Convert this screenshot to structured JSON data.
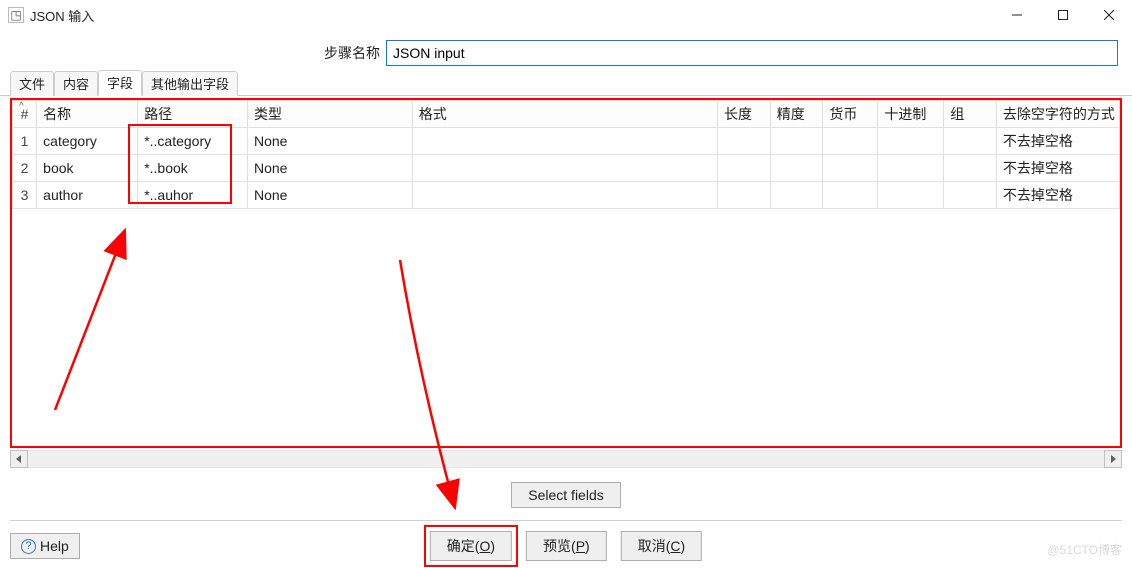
{
  "window": {
    "title": "JSON 输入",
    "minimize": "–",
    "maximize": "☐",
    "close": "✕"
  },
  "step": {
    "label": "步骤名称",
    "value": "JSON input"
  },
  "tabs": [
    {
      "label": "文件",
      "active": false
    },
    {
      "label": "内容",
      "active": false
    },
    {
      "label": "字段",
      "active": true
    },
    {
      "label": "其他输出字段",
      "active": false
    }
  ],
  "table": {
    "headers": {
      "idx": "#",
      "name": "名称",
      "path": "路径",
      "type": "类型",
      "format": "格式",
      "length": "长度",
      "precision": "精度",
      "currency": "货币",
      "decimal": "十进制",
      "group": "组",
      "trim": "去除空字符的方式"
    },
    "rows": [
      {
        "idx": "1",
        "name": "category",
        "path": "*..category",
        "type": "None",
        "format": "",
        "length": "",
        "precision": "",
        "currency": "",
        "decimal": "",
        "group": "",
        "trim": "不去掉空格"
      },
      {
        "idx": "2",
        "name": "book",
        "path": "*..book",
        "type": "None",
        "format": "",
        "length": "",
        "precision": "",
        "currency": "",
        "decimal": "",
        "group": "",
        "trim": "不去掉空格"
      },
      {
        "idx": "3",
        "name": "author",
        "path": "*..auhor",
        "type": "None",
        "format": "",
        "length": "",
        "precision": "",
        "currency": "",
        "decimal": "",
        "group": "",
        "trim": "不去掉空格"
      }
    ]
  },
  "buttons": {
    "select_fields": "Select fields",
    "ok": "确定(",
    "ok_u": "O",
    "ok_end": ")",
    "preview": "预览(",
    "preview_u": "P",
    "preview_end": ")",
    "cancel": "取消(",
    "cancel_u": "C",
    "cancel_end": ")",
    "help": "Help",
    "help_icon": "?"
  },
  "watermark": "@51CTO博客"
}
